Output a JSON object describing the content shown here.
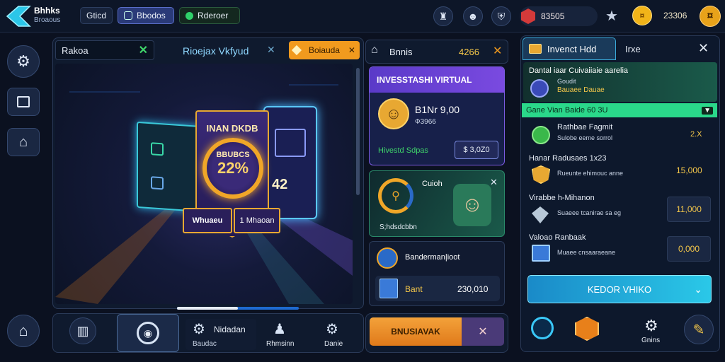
{
  "brand": {
    "line1": "Bhhks",
    "line2": "Broaous"
  },
  "top_tabs": [
    "Gticd",
    "Bbodos",
    "Rderoer"
  ],
  "stats": {
    "gems": "83505",
    "coins": "23306"
  },
  "left_nav": [
    "settings-icon",
    "book-icon",
    "home-icon"
  ],
  "main_header": {
    "left_label": "Rakoa",
    "title": "Rioejax Vkfyud",
    "promo": "Boiauda"
  },
  "card": {
    "title": "INAN DKDB",
    "ring_top": "BBUBCS",
    "ring_value": "22%",
    "side_value": "42",
    "btn_left": "Whuaeu",
    "btn_right": "1 Mhaoan"
  },
  "carousel": {
    "progress": 0.5
  },
  "right_col": {
    "header_label": "Bnnis",
    "header_value": "4266",
    "invest_title": "INVESSTASHI VIRTUAL",
    "invest_amount": "B1Nr 9,00",
    "invest_sub": "Ф3966",
    "invest_footer": "Hivestd Sdpas",
    "invest_value": "$ 3,0Z0",
    "promo_title": "Cuioh",
    "promo_footer": "S;hdsdcbbn",
    "bank_title": "Banderman|ioot",
    "bank_label": "Bant",
    "bank_value": "230,010"
  },
  "bottom_bar": {
    "items": [
      "Nidadan",
      "Rhmsinn",
      "Danie"
    ],
    "sub": "Baudac"
  },
  "action_bar": {
    "label": "BNUSIAVAK"
  },
  "side_panel": {
    "tab_active": "Invenct Hdd",
    "tab_other": "Irxe",
    "intro_title": "Dantal iaar Cuivaiiaie aarelia",
    "intro_sub1": "Goudit",
    "intro_sub2": "Bauaee Dauae",
    "banner": "Gane Vian Baide 60 3U",
    "rows": [
      {
        "title": "Rathbae Fagmit",
        "sub": "Sulobe eeme sorrol",
        "value": "2.X"
      },
      {
        "title": "Hanar Radusaes 1x23",
        "sub": "Rueunte ehimouc anne",
        "value": "15,000"
      },
      {
        "title": "Virabbe h-Mihanon",
        "sub": "Suaeee tcanirae sa eg",
        "value": "11,000"
      },
      {
        "title": "Valoao Ranbaak",
        "sub": "Muaee cnsaaraeane",
        "value": "0,000"
      }
    ],
    "cta": "KEDOR VHIKO",
    "bottom_label": "Gnins"
  }
}
